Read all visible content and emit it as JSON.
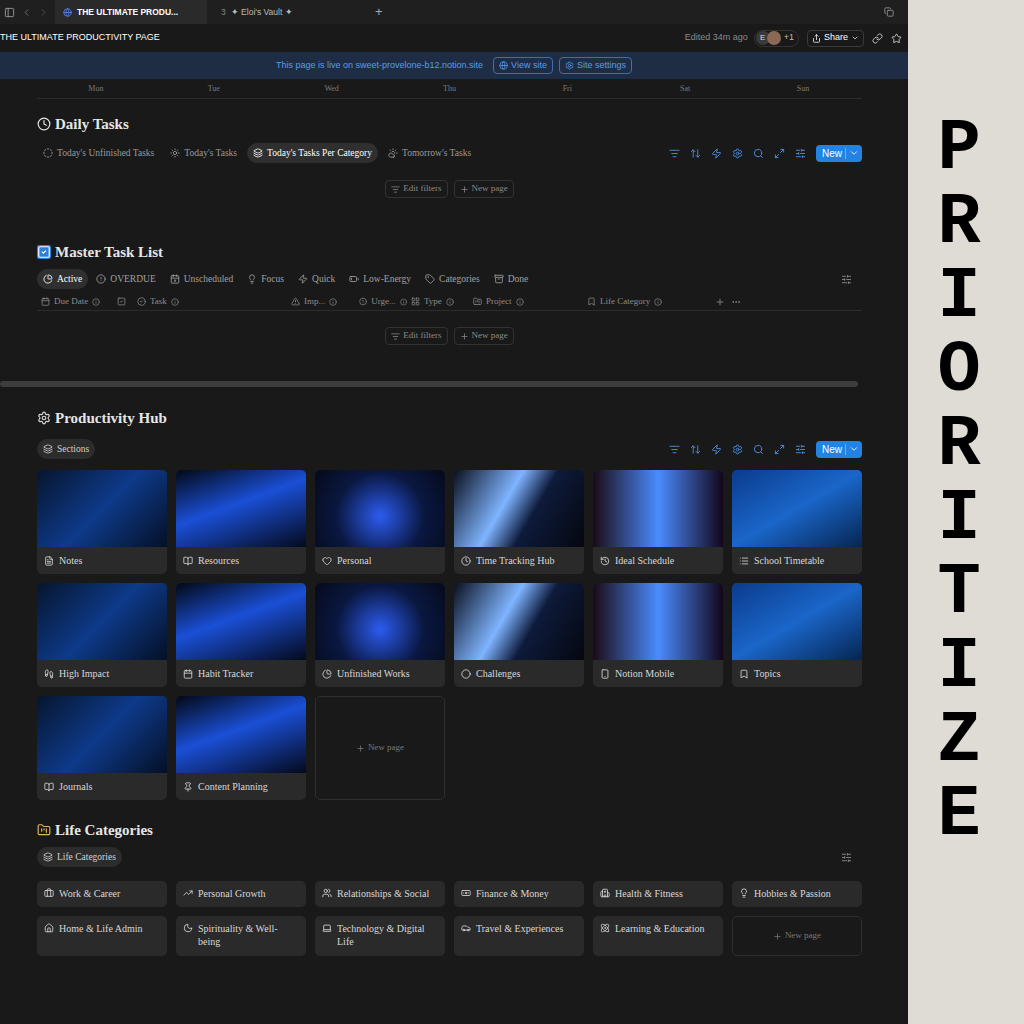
{
  "browser": {
    "tabs": [
      {
        "prefix": "",
        "label": "THE ULTIMATE PRODU...",
        "selected": true
      },
      {
        "prefix": "3",
        "label": "✦ Eloi's Vault ✦",
        "selected": false
      }
    ],
    "new_tab": "+"
  },
  "topbar": {
    "title": "THE ULTIMATE PRODUCTIVITY PAGE",
    "edited": "Edited 34m ago",
    "avatar": "E",
    "extra": "+1",
    "share": "Share"
  },
  "banner": {
    "text": "This page is live on sweet-provelone-b12.notion.site",
    "buttons": [
      "View site",
      "Site settings"
    ]
  },
  "calendar": {
    "weekdays": [
      "Mon",
      "Tue",
      "Wed",
      "Thu",
      "Fri",
      "Sat",
      "Sun"
    ]
  },
  "daily_tasks": {
    "title": "Daily Tasks",
    "views": [
      {
        "label": "Today's Unfinished Tasks",
        "selected": false
      },
      {
        "label": "Today's Tasks",
        "selected": false
      },
      {
        "label": "Today's Tasks Per Category",
        "selected": true
      },
      {
        "label": "Tomorrow's Tasks",
        "selected": false
      }
    ],
    "new_button": "New",
    "actions": [
      "Edit filters",
      "New page"
    ]
  },
  "master_task_list": {
    "title": "Master Task List",
    "views": [
      {
        "label": "Active",
        "selected": true
      },
      {
        "label": "OVERDUE",
        "selected": false
      },
      {
        "label": "Unscheduled",
        "selected": false
      },
      {
        "label": "Focus",
        "selected": false
      },
      {
        "label": "Quick",
        "selected": false
      },
      {
        "label": "Low-Energy",
        "selected": false
      },
      {
        "label": "Categories",
        "selected": false
      },
      {
        "label": "Done",
        "selected": false
      }
    ],
    "columns": [
      {
        "label": "Due Date",
        "kind": "labeled"
      },
      {
        "label": "",
        "kind": "icon"
      },
      {
        "label": "Task",
        "kind": "labeled"
      },
      {
        "label": "Imp...",
        "kind": "labeled"
      },
      {
        "label": "Urge...",
        "kind": "labeled"
      },
      {
        "label": "Type",
        "kind": "labeled"
      },
      {
        "label": "Project",
        "kind": "labeled"
      },
      {
        "label": "Life Category",
        "kind": "labeled"
      }
    ],
    "actions": [
      "Edit filters",
      "New page"
    ]
  },
  "productivity_hub": {
    "title": "Productivity Hub",
    "view": "Sections",
    "new_button": "New",
    "cards": [
      "Notes",
      "Resources",
      "Personal",
      "Time Tracking Hub",
      "Ideal Schedule",
      "School Timetable",
      "High Impact",
      "Habit Tracker",
      "Unfinished Works",
      "Challenges",
      "Notion Mobile",
      "Topics",
      "Journals",
      "Content Planning"
    ],
    "new_page": "New page"
  },
  "life_categories": {
    "title": "Life Categories",
    "view": "Life Categories",
    "items": [
      "Work & Career",
      "Personal Growth",
      "Relationships & Social",
      "Finance & Money",
      "Health & Fitness",
      "Hobbies & Passion",
      "Home & Life Admin",
      "Spirituality & Well-being",
      "Technology & Digital Life",
      "Travel & Experiences",
      "Learning & Education"
    ],
    "new_page": "New page"
  },
  "side_panel": {
    "word": "PRIORITIZE"
  }
}
